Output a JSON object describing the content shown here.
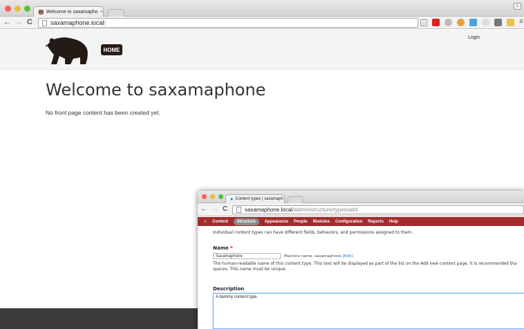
{
  "front_window": {
    "tab_title": "Welcome to saxamapho",
    "url_host": "saxamaphone.local",
    "url_path": "/",
    "header": {
      "home_label": "HOME",
      "login_label": "Login"
    },
    "main": {
      "title": "Welcome to saxamaphone",
      "message": "No front page content has been created yet."
    }
  },
  "admin_window": {
    "tab_title": "Content types | saxamaph",
    "url_host": "saxamaphone.local",
    "url_path": "/admin/structure/types/add",
    "toolbar": {
      "items": [
        "Content",
        "Structure",
        "Appearance",
        "People",
        "Modules",
        "Configuration",
        "Reports",
        "Help"
      ],
      "active": "Structure"
    },
    "intro": "Individual content types can have different fields, behaviors, and permissions assigned to them.",
    "name_field": {
      "label": "Name",
      "required_mark": "*",
      "value": "Saxamaphone",
      "machine_name_prefix": "Machine name: saxamaphone",
      "edit_link": "[Edit]",
      "help_line1": "The human-readable name of this content type. This text will be displayed as part of the list on the Add new content page. It is recommended tha",
      "help_line2": "spaces. This name must be unique."
    },
    "description_field": {
      "label": "Description",
      "value": "A dummy content type."
    }
  },
  "colors": {
    "admin_bar": "#a22c2c",
    "home_button": "#2a1c16",
    "traffic_red": "#fc5b57",
    "traffic_yellow": "#e5bf3c",
    "traffic_green": "#57c038"
  }
}
